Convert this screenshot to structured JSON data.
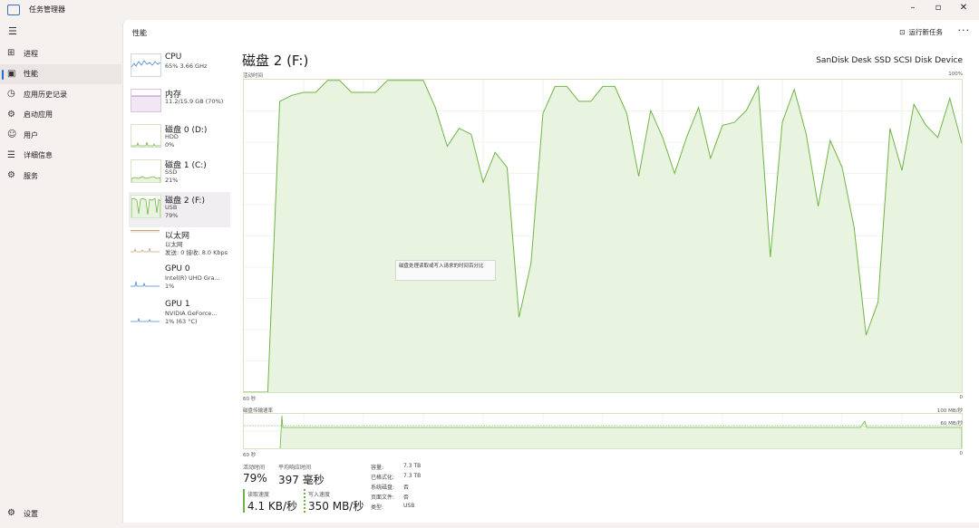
{
  "window": {
    "title": "任务管理器"
  },
  "window_controls": {
    "minimize": "–",
    "maximize": "▫",
    "close": "✕"
  },
  "nav": {
    "items": [
      {
        "label": "进程",
        "icon": "⊞"
      },
      {
        "label": "性能",
        "icon": "▣"
      },
      {
        "label": "应用历史记录",
        "icon": "◷"
      },
      {
        "label": "启动应用",
        "icon": "⚙"
      },
      {
        "label": "用户",
        "icon": "☺"
      },
      {
        "label": "详细信息",
        "icon": "☰"
      },
      {
        "label": "服务",
        "icon": "⚙"
      }
    ],
    "settings": "设置"
  },
  "header": {
    "title": "性能",
    "run_task": "运行新任务",
    "more": "···"
  },
  "devices": [
    {
      "name": "CPU",
      "sub1": "65% 3.66 GHz",
      "sub2": ""
    },
    {
      "name": "内存",
      "sub1": "11.2/15.9 GB (70%)",
      "sub2": ""
    },
    {
      "name": "磁盘 0 (D:)",
      "sub1": "HDD",
      "sub2": "0%"
    },
    {
      "name": "磁盘 1 (C:)",
      "sub1": "SSD",
      "sub2": "21%"
    },
    {
      "name": "磁盘 2 (F:)",
      "sub1": "USB",
      "sub2": "79%"
    },
    {
      "name": "以太网",
      "sub1": "以太网",
      "sub2": "发送: 0 接收: 8.0 Kbps"
    },
    {
      "name": "GPU 0",
      "sub1": "Intel(R) UHD Gra...",
      "sub2": "1%"
    },
    {
      "name": "GPU 1",
      "sub1": "NVIDIA GeForce...",
      "sub2": "1% (63 °C)"
    }
  ],
  "main": {
    "title": "磁盘 2 (F:)",
    "device_name": "SanDisk Desk SSD SCSI Disk Device",
    "graph1": {
      "label": "活动时间",
      "max_label": "100%",
      "time_left": "60 秒",
      "time_right": "0"
    },
    "graph2": {
      "label": "磁盘传输速率",
      "max_label": "100 MB/秒",
      "mid_label": "60 MB/秒",
      "time_left": "60 秒",
      "time_right": "0"
    },
    "tooltip": "磁盘处理读取或写入请求的时间百分比",
    "stats": {
      "active_time_label": "活动时间",
      "active_time_value": "79%",
      "avg_response_label": "平均响应时间",
      "avg_response_value": "397 毫秒",
      "read_speed_label": "读取速度",
      "read_speed_value": "4.1 KB/秒",
      "write_speed_label": "写入速度",
      "write_speed_value": "350 MB/秒"
    },
    "props": [
      {
        "k": "容量:",
        "v": "7.3 TB"
      },
      {
        "k": "已格式化:",
        "v": "7.3 TB"
      },
      {
        "k": "系统磁盘:",
        "v": "否"
      },
      {
        "k": "页面文件:",
        "v": "否"
      },
      {
        "k": "类型:",
        "v": "USB"
      }
    ]
  },
  "colors": {
    "accent": "#1f6fd1",
    "disk_line": "#6fb545",
    "disk_fill": "#e9f4e0",
    "grid": "#e3eddb",
    "read_bar": "#6fb545",
    "write_bar": "#6fb545"
  },
  "chart_data": {
    "type": "area",
    "x": [
      60,
      59,
      58,
      57,
      56,
      55,
      54,
      53,
      52,
      51,
      50,
      49,
      48,
      47,
      46,
      45,
      44,
      43,
      42,
      41,
      40,
      39,
      38,
      37,
      36,
      35,
      34,
      33,
      32,
      31,
      30,
      29,
      28,
      27,
      26,
      25,
      24,
      23,
      22,
      21,
      20,
      19,
      18,
      17,
      16,
      15,
      14,
      13,
      12,
      11,
      10,
      9,
      8,
      7,
      6,
      5,
      4,
      3,
      2,
      1,
      0
    ],
    "series": [
      {
        "values": [
          0,
          0,
          0,
          97,
          99,
          100,
          100,
          104,
          104,
          100,
          100,
          100,
          104,
          104,
          104,
          104,
          95,
          82,
          88,
          86,
          70,
          80,
          75,
          25,
          43,
          93,
          102,
          102,
          97,
          97,
          102,
          102,
          93,
          72,
          94,
          85,
          73,
          85,
          95,
          78,
          89,
          90,
          94,
          102,
          45,
          90,
          101,
          86,
          62,
          84,
          75,
          55,
          19,
          30,
          88,
          74,
          96,
          89,
          85,
          98,
          83
        ]
      }
    ],
    "y_range": [
      0,
      100
    ],
    "x_range": [
      60,
      0
    ],
    "grid": true
  }
}
